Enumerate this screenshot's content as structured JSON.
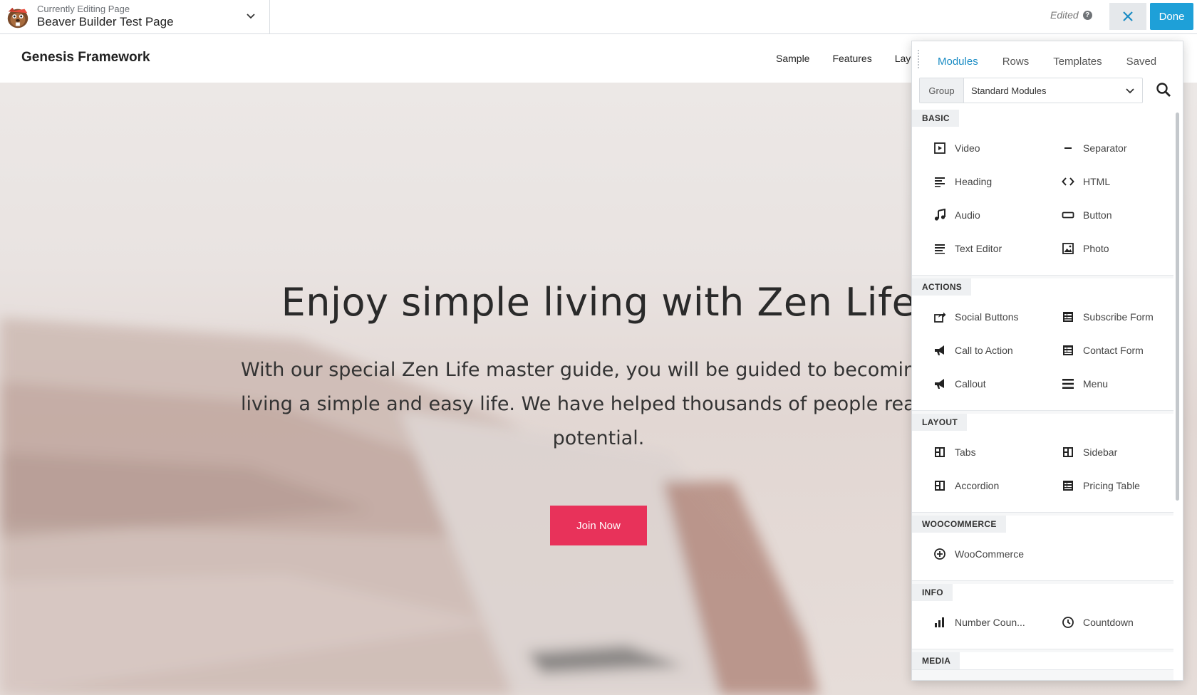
{
  "topbar": {
    "editing_small": "Currently Editing Page",
    "editing_title": "Beaver Builder Test Page",
    "edited": "Edited",
    "help": "?",
    "done": "Done"
  },
  "site": {
    "title": "Genesis Framework",
    "nav": [
      "Sample",
      "Features",
      "Lay"
    ]
  },
  "hero": {
    "title": "Enjoy simple living with Zen Life",
    "body_lines": [
      "With our special Zen Life master guide, you will be guided to becoming a pe",
      "living a simple and easy life. We have helped thousands of people reach th",
      "potential."
    ],
    "button": "Join Now",
    "button_color": "#e8325a"
  },
  "panel": {
    "tabs": [
      "Modules",
      "Rows",
      "Templates",
      "Saved"
    ],
    "active_tab": "Modules",
    "group_label": "Group",
    "group_value": "Standard Modules",
    "sections": [
      {
        "name": "BASIC",
        "items": [
          {
            "label": "Video",
            "icon": "video-icon"
          },
          {
            "label": "Separator",
            "icon": "separator-icon"
          },
          {
            "label": "Heading",
            "icon": "heading-icon"
          },
          {
            "label": "HTML",
            "icon": "html-icon"
          },
          {
            "label": "Audio",
            "icon": "audio-icon"
          },
          {
            "label": "Button",
            "icon": "button-icon"
          },
          {
            "label": "Text Editor",
            "icon": "text-editor-icon"
          },
          {
            "label": "Photo",
            "icon": "photo-icon"
          }
        ]
      },
      {
        "name": "ACTIONS",
        "items": [
          {
            "label": "Social Buttons",
            "icon": "share-icon"
          },
          {
            "label": "Subscribe Form",
            "icon": "form-icon"
          },
          {
            "label": "Call to Action",
            "icon": "megaphone-icon"
          },
          {
            "label": "Contact Form",
            "icon": "form-icon"
          },
          {
            "label": "Callout",
            "icon": "megaphone-icon"
          },
          {
            "label": "Menu",
            "icon": "menu-icon"
          }
        ]
      },
      {
        "name": "LAYOUT",
        "items": [
          {
            "label": "Tabs",
            "icon": "layout-icon"
          },
          {
            "label": "Sidebar",
            "icon": "layout-icon"
          },
          {
            "label": "Accordion",
            "icon": "layout-icon"
          },
          {
            "label": "Pricing Table",
            "icon": "form-icon"
          }
        ]
      },
      {
        "name": "WOOCOMMERCE",
        "items": [
          {
            "label": "WooCommerce",
            "icon": "plus-circle-icon"
          }
        ]
      },
      {
        "name": "INFO",
        "items": [
          {
            "label": "Number Coun...",
            "icon": "bar-chart-icon"
          },
          {
            "label": "Countdown",
            "icon": "clock-icon"
          }
        ]
      },
      {
        "name": "MEDIA",
        "items": []
      }
    ]
  },
  "colors": {
    "accent_blue": "#1ea0d8",
    "tab_active": "#1a8cc4"
  }
}
